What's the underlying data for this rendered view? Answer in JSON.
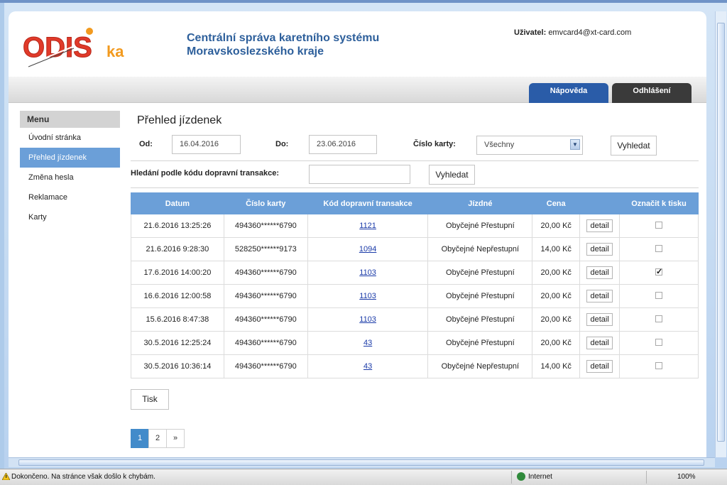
{
  "header": {
    "title_line1": "Centrální správa karetního systému",
    "title_line2": "Moravskoslezského kraje",
    "user_label": "Uživatel:",
    "user_name": "emvcard4@xt-card.com",
    "logo_text": "ODISka"
  },
  "nav": {
    "help": "Nápověda",
    "logout": "Odhlášení"
  },
  "sidebar": {
    "heading": "Menu",
    "items": [
      {
        "label": "Úvodní stránka"
      },
      {
        "label": "Přehled jízdenek"
      },
      {
        "label": "Změna hesla"
      },
      {
        "label": "Reklamace"
      },
      {
        "label": "Karty"
      }
    ]
  },
  "main": {
    "title": "Přehled jízdenek",
    "from_label": "Od:",
    "from_value": "16.04.2016",
    "to_label": "Do:",
    "to_value": "23.06.2016",
    "card_label": "Číslo karty:",
    "card_value": "Všechny",
    "search_label": "Vyhledat",
    "code_search_label": "Hledání podle kódu dopravní transakce:",
    "code_value": "",
    "code_search_button": "Vyhledat",
    "print_button": "Tisk"
  },
  "table": {
    "headers": [
      "Datum",
      "Číslo karty",
      "Kód dopravní transakce",
      "Jízdné",
      "Cena",
      "",
      "Označit k tisku"
    ],
    "detail_label": "detail",
    "rows": [
      {
        "date": "21.6.2016 13:25:26",
        "card": "494360******6790",
        "code": "1121",
        "fare": "Obyčejné Přestupní",
        "price": "20,00 Kč",
        "checked": false
      },
      {
        "date": "21.6.2016 9:28:30",
        "card": "528250******9173",
        "code": "1094",
        "fare": "Obyčejné Nepřestupní",
        "price": "14,00 Kč",
        "checked": false
      },
      {
        "date": "17.6.2016 14:00:20",
        "card": "494360******6790",
        "code": "1103",
        "fare": "Obyčejné Přestupní",
        "price": "20,00 Kč",
        "checked": true
      },
      {
        "date": "16.6.2016 12:00:58",
        "card": "494360******6790",
        "code": "1103",
        "fare": "Obyčejné Přestupní",
        "price": "20,00 Kč",
        "checked": false
      },
      {
        "date": "15.6.2016 8:47:38",
        "card": "494360******6790",
        "code": "1103",
        "fare": "Obyčejné Přestupní",
        "price": "20,00 Kč",
        "checked": false
      },
      {
        "date": "30.5.2016 12:25:24",
        "card": "494360******6790",
        "code": "43",
        "fare": "Obyčejné Přestupní",
        "price": "20,00 Kč",
        "checked": false
      },
      {
        "date": "30.5.2016 10:36:14",
        "card": "494360******6790",
        "code": "43",
        "fare": "Obyčejné Nepřestupní",
        "price": "14,00 Kč",
        "checked": false
      }
    ]
  },
  "pagination": {
    "pages": [
      "1",
      "2"
    ],
    "current": "1",
    "next": "»"
  },
  "statusbar": {
    "message": "Dokončeno. Na stránce však došlo k chybám.",
    "zone": "Internet",
    "zoom": "100%"
  },
  "colors": {
    "accent": "#6b9fd8",
    "brand_title": "#2d5f9b",
    "help_tab": "#2a5ca8",
    "logout_tab": "#3a3a3a",
    "logo_red": "#e03a2a",
    "logo_orange": "#f29a1f"
  }
}
